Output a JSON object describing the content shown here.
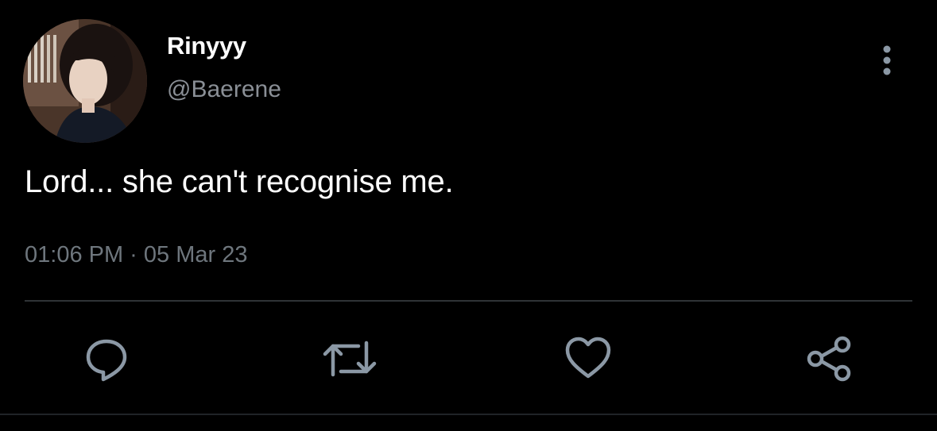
{
  "tweet": {
    "display_name": "Rinyyy",
    "handle": "@Baerene",
    "text": "Lord... she can't recognise me.",
    "timestamp": "01:06 PM · 05 Mar 23"
  },
  "icons": {
    "more": "more-vertical-icon",
    "reply": "reply-icon",
    "retweet": "retweet-icon",
    "like": "heart-icon",
    "share": "share-icon"
  },
  "colors": {
    "background": "#000000",
    "text_primary": "#ffffff",
    "text_secondary": "#8a8f96",
    "icon": "#8b98a5",
    "divider": "#2f3336"
  }
}
